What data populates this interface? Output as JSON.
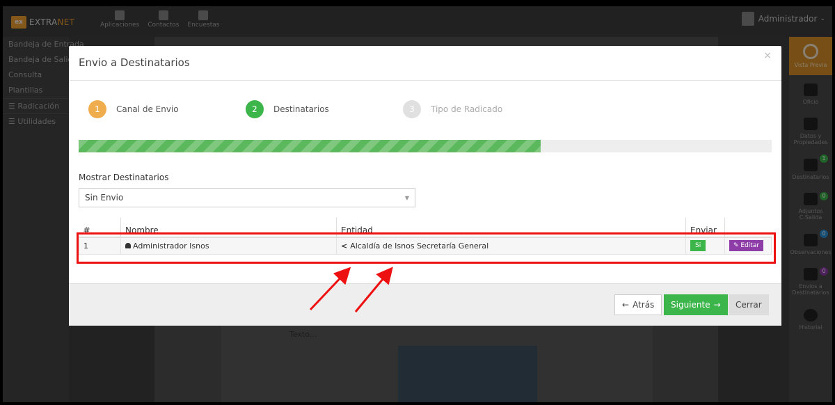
{
  "app": {
    "logo_text_a": "EXTRA",
    "logo_text_b": "NET",
    "top_nav": [
      {
        "label": "Aplicaciones",
        "icon": "pen-icon"
      },
      {
        "label": "Contactos",
        "icon": "contacts-icon"
      },
      {
        "label": "Encuestas",
        "icon": "document-icon"
      }
    ],
    "user_name": "Administrador"
  },
  "left_sidebar": {
    "items": [
      "Bandeja de Entrada",
      "Bandeja de Salida",
      "Consulta",
      "Plantillas"
    ],
    "sections": [
      "Radicación",
      "Utilidades"
    ]
  },
  "right_sidebar": {
    "top_label": "Vista Previa",
    "items": [
      {
        "label": "Oficio",
        "icon": "edit-icon",
        "badge": ""
      },
      {
        "label": "Datos y Propiedades",
        "icon": "grid-icon",
        "badge": ""
      },
      {
        "label": "Destinatarios",
        "icon": "user-icon",
        "badge": "1"
      },
      {
        "label": "Adjuntos C.Salida",
        "icon": "paperclip-icon",
        "badge": "0"
      },
      {
        "label": "Observaciones",
        "icon": "comment-icon",
        "badge": "0"
      },
      {
        "label": "Envios a Destinatarios",
        "icon": "truck-icon",
        "badge": "0"
      },
      {
        "label": "Historial",
        "icon": "clock-icon",
        "badge": ""
      }
    ]
  },
  "background": {
    "text": "Texto..."
  },
  "modal": {
    "title": "Envio a Destinatarios",
    "close": "×",
    "steps": [
      {
        "number": "1",
        "label": "Canal de Envio",
        "color": "#f0ad4e"
      },
      {
        "number": "2",
        "label": "Destinatarios",
        "color": "#3cb54a"
      },
      {
        "number": "3",
        "label": "Tipo de Radicado",
        "color": "#e0e0e0"
      }
    ],
    "progress_fraction": 0.667,
    "mostrar_label": "Mostrar Destinatarios",
    "select_value": "Sin Envio",
    "table": {
      "headers": [
        "#",
        "Nombre",
        "Entidad",
        "Enviar",
        ""
      ],
      "rows": [
        {
          "num": "1",
          "nombre": "Administrador Isnos",
          "entidad": "Alcaldía de Isnos Secretaría General",
          "enviar": "Si",
          "accion": "Editar"
        }
      ]
    },
    "footer": {
      "atras": "Atrás",
      "siguiente": "Siguiente",
      "cerrar": "Cerrar"
    }
  },
  "colors": {
    "accent_green": "#3cb54a",
    "accent_orange": "#f0ad4e",
    "accent_purple": "#8e3ca8",
    "highlight_red": "#e11111"
  }
}
